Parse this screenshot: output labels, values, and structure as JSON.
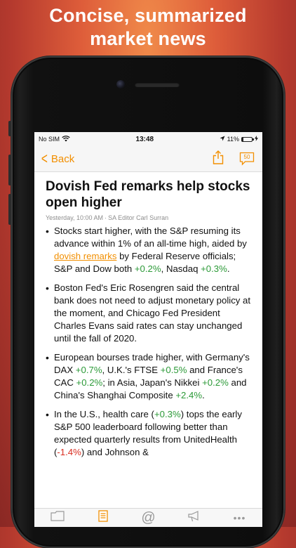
{
  "headline": {
    "line1": "Concise, summarized",
    "line2": "market news"
  },
  "status_bar": {
    "carrier": "No SIM",
    "time": "13:48",
    "battery_text": "11%",
    "battery_level": 0.11
  },
  "nav": {
    "back_label": "Back",
    "comment_count": "50"
  },
  "article": {
    "title": "Dovish Fed remarks help stocks open higher",
    "date": "Yesterday, 10:00 AM",
    "author": "SA Editor Carl Surran",
    "byline_sep": "·",
    "bullet1": {
      "t1": "Stocks start higher, with the S&P resuming its advance within 1% of an all-time high, aided by ",
      "link": "dovish remarks",
      "t2": " by Federal Reserve officials; S&P and Dow both ",
      "v1": "+0.2%",
      "t3": ", Nasdaq ",
      "v2": "+0.3%",
      "t4": "."
    },
    "bullet2": {
      "text": "Boston Fed's Eric Rosengren said the central bank does not need to adjust monetary policy at the moment, and Chicago Fed President Charles Evans said rates can stay unchanged until the fall of 2020."
    },
    "bullet3": {
      "t1": "European bourses trade higher, with Germany's DAX ",
      "v1": "+0.7%",
      "t2": ", U.K.'s FTSE ",
      "v2": "+0.5%",
      "t3": " and France's CAC ",
      "v3": "+0.2%",
      "t4": "; in Asia, Japan's Nikkei ",
      "v4": "+0.2%",
      "t5": " and China's Shanghai Composite ",
      "v5": "+2.4%",
      "t6": "."
    },
    "bullet4": {
      "t1": "In the U.S., health care (",
      "v1": "+0.3%",
      "t2": ") tops the early S&P 500 leaderboard following better than expected quarterly results from UnitedHealth (",
      "v2": "-1.4%",
      "t3": ") and Johnson &"
    }
  },
  "colors": {
    "accent": "#f28f00",
    "positive": "#2c9a38",
    "negative": "#d92d20",
    "background_top": "#f08a4a",
    "background_bottom": "#8a2824"
  },
  "icons": {
    "wifi": "wifi-icon",
    "location": "location-arrow-icon",
    "charging": "bolt-icon",
    "share": "share-icon",
    "comment": "comment-bubble-icon",
    "tabs": [
      "folder-icon",
      "document-icon",
      "at-sign-icon",
      "megaphone-icon",
      "more-icon"
    ]
  }
}
